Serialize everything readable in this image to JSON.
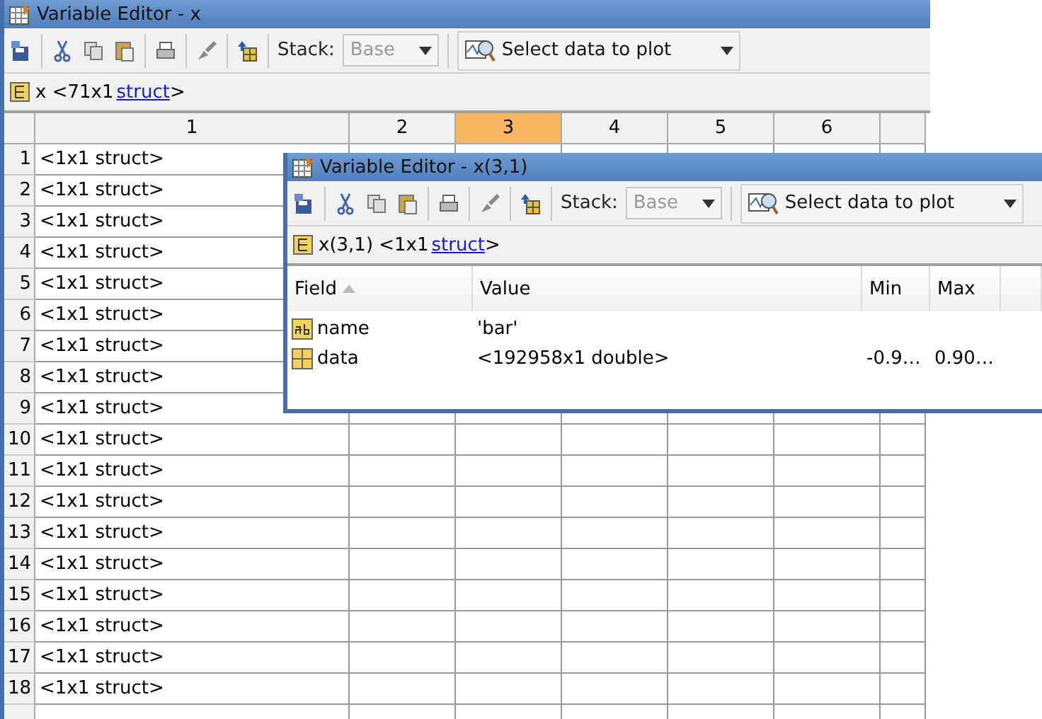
{
  "main_window": {
    "title": "Variable Editor - x",
    "toolbar": {
      "stack_label": "Stack:",
      "stack_value": "Base",
      "plot_button": "Select data to plot"
    },
    "breadcrumb": {
      "prefix": "x <71x1",
      "link": "struct",
      "suffix": ">"
    },
    "columns": [
      {
        "label": "1",
        "selected": false
      },
      {
        "label": "2",
        "selected": false
      },
      {
        "label": "3",
        "selected": true
      },
      {
        "label": "4",
        "selected": false
      },
      {
        "label": "5",
        "selected": false
      },
      {
        "label": "6",
        "selected": false
      }
    ],
    "rows": [
      {
        "number": "1",
        "cell": "<1x1 struct>"
      },
      {
        "number": "2",
        "cell": "<1x1 struct>"
      },
      {
        "number": "3",
        "cell": "<1x1 struct>"
      },
      {
        "number": "4",
        "cell": "<1x1 struct>"
      },
      {
        "number": "5",
        "cell": "<1x1 struct>"
      },
      {
        "number": "6",
        "cell": "<1x1 struct>"
      },
      {
        "number": "7",
        "cell": "<1x1 struct>"
      },
      {
        "number": "8",
        "cell": "<1x1 struct>"
      },
      {
        "number": "9",
        "cell": "<1x1 struct>"
      },
      {
        "number": "10",
        "cell": "<1x1 struct>"
      },
      {
        "number": "11",
        "cell": "<1x1 struct>"
      },
      {
        "number": "12",
        "cell": "<1x1 struct>"
      },
      {
        "number": "13",
        "cell": "<1x1 struct>"
      },
      {
        "number": "14",
        "cell": "<1x1 struct>"
      },
      {
        "number": "15",
        "cell": "<1x1 struct>"
      },
      {
        "number": "16",
        "cell": "<1x1 struct>"
      },
      {
        "number": "17",
        "cell": "<1x1 struct>"
      },
      {
        "number": "18",
        "cell": "<1x1 struct>"
      }
    ]
  },
  "sub_window": {
    "title": "Variable Editor - x(3,1)",
    "toolbar": {
      "stack_label": "Stack:",
      "stack_value": "Base",
      "plot_button": "Select data to plot"
    },
    "breadcrumb": {
      "prefix": "x(3,1) <1x1",
      "link": "struct",
      "suffix": ">"
    },
    "columns": [
      "Field",
      "Value",
      "Min",
      "Max"
    ],
    "fields": [
      {
        "kind": "text",
        "name": "name",
        "value": "'bar'"
      },
      {
        "kind": "array",
        "name": "data",
        "value": "<192958x1 double>",
        "min": "-0.9…",
        "max": "0.90…"
      }
    ]
  }
}
